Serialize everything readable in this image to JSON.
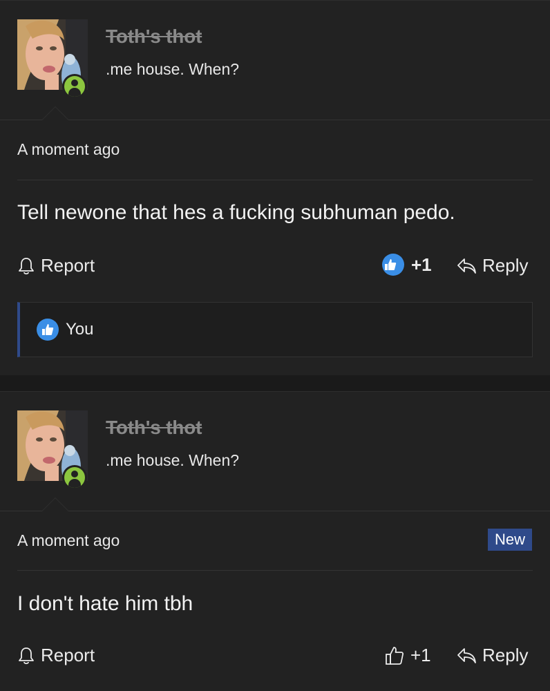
{
  "colors": {
    "accent": "#3a8ee6",
    "online": "#8cc63f",
    "new_badge": "#2f4a8a"
  },
  "posts": [
    {
      "author": {
        "name": "Toth's thot",
        "title": ".me house. When?",
        "status_icon": "user-online-icon"
      },
      "timestamp": "A moment ago",
      "message": "Tell newone that hes a fucking subhuman pedo.",
      "actions": {
        "report": "Report",
        "reaction_count": "+1",
        "reply": "Reply"
      },
      "reactions": {
        "label": "You",
        "icon": "like-icon"
      }
    },
    {
      "author": {
        "name": "Toth's thot",
        "title": ".me house. When?",
        "status_icon": "user-online-icon"
      },
      "timestamp": "A moment ago",
      "badge": "New",
      "message": "I don't hate him tbh",
      "actions": {
        "report": "Report",
        "reaction_count": "+1",
        "reply": "Reply"
      }
    }
  ]
}
